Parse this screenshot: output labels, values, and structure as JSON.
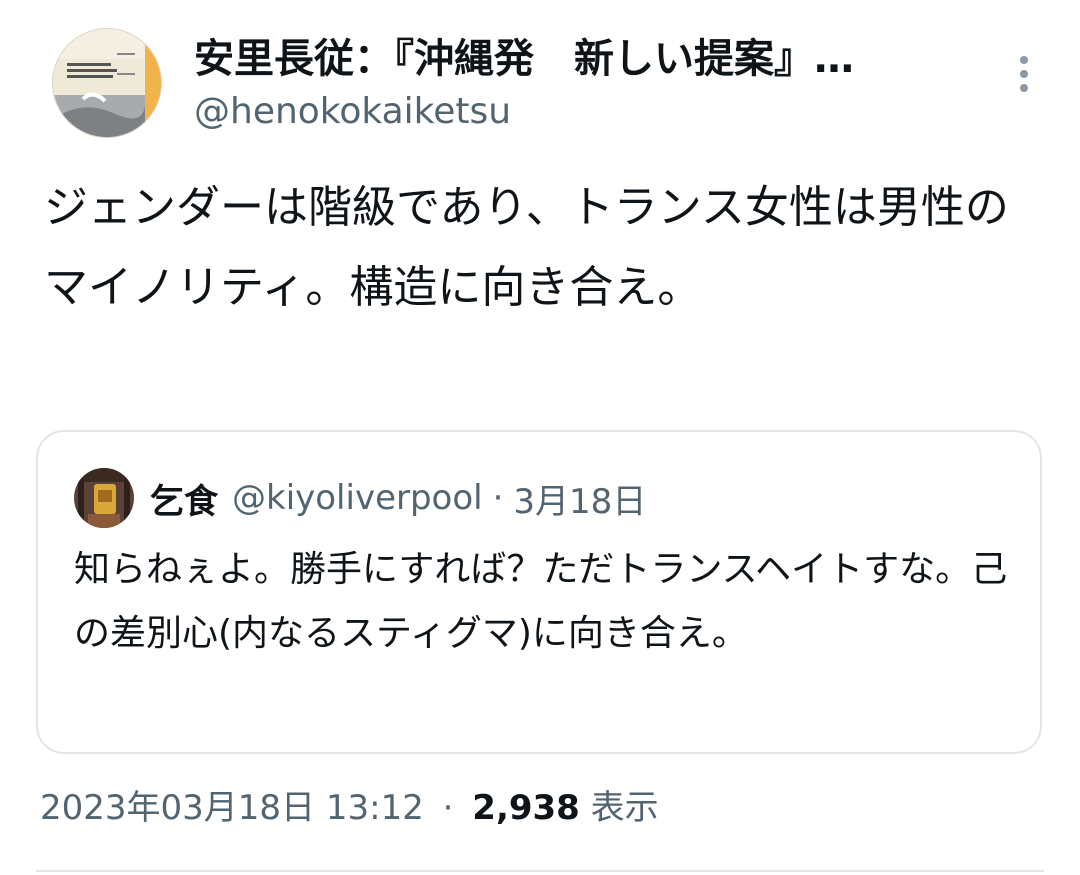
{
  "author": {
    "display_name": "安里長従：『沖縄発　新しい提案』…",
    "handle": "@henokokaiketsu"
  },
  "tweet": {
    "text": "ジェンダーは階級であり、トランス女性は男性のマイノリティ。構造に向き合え。"
  },
  "quoted_tweet": {
    "display_name": "乞食",
    "handle": "@kiyoliverpool",
    "separator": "·",
    "date": "3月18日",
    "text": "知らねぇよ。勝手にすれば？ただトランスヘイトすな。己の差別心(内なるスティグマ)に向き合え。"
  },
  "meta": {
    "timestamp": "2023年03月18日 13:12",
    "separator": "·",
    "views_count": "2,938",
    "views_label": "表示"
  },
  "icons": {
    "more": "more-vertical-icon"
  },
  "colors": {
    "text": "#0f1419",
    "secondary": "#536471",
    "border": "#e3e6e8"
  }
}
